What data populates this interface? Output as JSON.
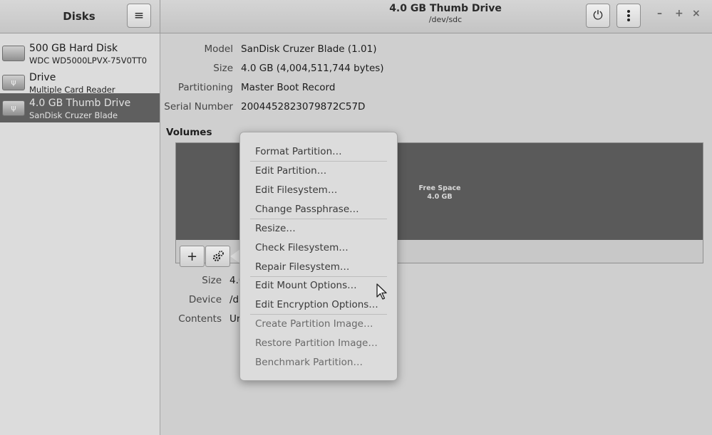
{
  "sidebar_header": {
    "title": "Disks",
    "menu_icon": "hamburger-icon"
  },
  "header": {
    "title": "4.0 GB Thumb Drive",
    "subtitle": "/dev/sdc",
    "power_icon": "power-icon",
    "more_icon": "vertical-dots-icon",
    "minimize": "–",
    "maximize": "+",
    "close": "×"
  },
  "sidebar": {
    "items": [
      {
        "name": "500 GB Hard Disk",
        "sub": "WDC WD5000LPVX-75V0TT0",
        "selected": false
      },
      {
        "name": "Drive",
        "sub": "Multiple Card  Reader",
        "selected": false
      },
      {
        "name": "4.0 GB Thumb Drive",
        "sub": "SanDisk Cruzer Blade",
        "selected": true
      }
    ]
  },
  "info": {
    "model_label": "Model",
    "model": "SanDisk Cruzer Blade (1.01)",
    "size_label": "Size",
    "size": "4.0 GB (4,004,511,744 bytes)",
    "partitioning_label": "Partitioning",
    "partitioning": "Master Boot Record",
    "serial_label": "Serial Number",
    "serial": "2004452823079872C57D"
  },
  "volumes": {
    "heading": "Volumes",
    "segment_label": "Free Space",
    "segment_size": "4.0 GB",
    "add_button": "+",
    "gear_icon": "gears-icon"
  },
  "details": {
    "size_label": "Size",
    "size_value": "4.0",
    "device_label": "Device",
    "device_value": "/d",
    "contents_label": "Contents",
    "contents_value": "Ur"
  },
  "menu": {
    "items": [
      {
        "label": "Format Partition…",
        "enabled": true
      },
      {
        "label": "Edit Partition…",
        "enabled": true
      },
      {
        "label": "Edit Filesystem…",
        "enabled": true
      },
      {
        "label": "Change Passphrase…",
        "enabled": true
      },
      {
        "label": "Resize…",
        "enabled": true
      },
      {
        "label": "Check Filesystem…",
        "enabled": true
      },
      {
        "label": "Repair Filesystem…",
        "enabled": true
      },
      {
        "label": "Edit Mount Options…",
        "enabled": true
      },
      {
        "label": "Edit Encryption Options…",
        "enabled": true
      },
      {
        "label": "Create Partition Image…",
        "enabled": false
      },
      {
        "label": "Restore Partition Image…",
        "enabled": false
      },
      {
        "label": "Benchmark Partition…",
        "enabled": false
      }
    ]
  }
}
